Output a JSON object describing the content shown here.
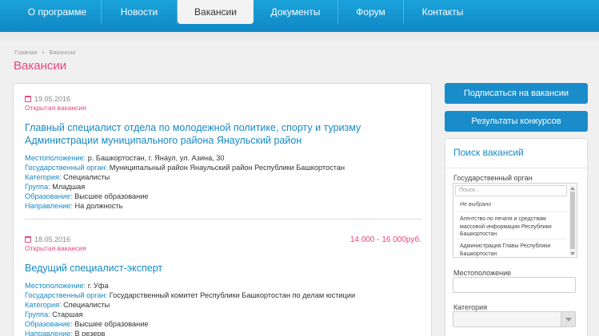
{
  "nav": {
    "items": [
      {
        "label": "О программе"
      },
      {
        "label": "Новости"
      },
      {
        "label": "Вакансии"
      },
      {
        "label": "Документы"
      },
      {
        "label": "Форум"
      },
      {
        "label": "Контакты"
      }
    ],
    "active_index": 2
  },
  "breadcrumb": {
    "home": "Главная",
    "current": "Вакансии"
  },
  "page_title": "Вакансии",
  "vacancies": [
    {
      "date": "19.05.2016",
      "status": "Открытая вакансия",
      "salary": "",
      "title": "Главный специалист отдела по молодежной политике, спорту и туризму Администрации муниципального района Янаульский район",
      "fields": [
        {
          "label": "Местоположение:",
          "value": "р. Башкортостан, г. Янаул, ул. Азина, 30"
        },
        {
          "label": "Государственный орган:",
          "value": "Муниципальный район Янаульский район Республики Башкортостан"
        },
        {
          "label": "Категория:",
          "value": "Специалисты"
        },
        {
          "label": "Группа:",
          "value": "Младшая"
        },
        {
          "label": "Образование:",
          "value": "Высшее образование"
        },
        {
          "label": "Направление:",
          "value": "На должность"
        }
      ]
    },
    {
      "date": "18.05.2016",
      "status": "Открытая вакансия",
      "salary": "14 000 - 16 000руб.",
      "title": "Ведущий специалист-эксперт",
      "fields": [
        {
          "label": "Местоположение:",
          "value": "г. Уфа"
        },
        {
          "label": "Государственный орган:",
          "value": "Государственный комитет Республики Башкортостан по делам юстиции"
        },
        {
          "label": "Категория:",
          "value": "Специалисты"
        },
        {
          "label": "Группа:",
          "value": "Старшая"
        },
        {
          "label": "Образование:",
          "value": "Высшее образование"
        },
        {
          "label": "Направление:",
          "value": "В резерв"
        }
      ]
    }
  ],
  "sidebar": {
    "subscribe_button": "Подписаться на вакансии",
    "results_button": "Результаты конкурсов",
    "search": {
      "title": "Поиск вакансий",
      "org_label": "Государственный орган",
      "org_search_placeholder": "Поиск...",
      "org_options": [
        "Не выбрано",
        "Агентство по печати и средствам массовой информации Республики Башкортостан",
        "Администрация Главы Республики Башкортостан"
      ],
      "location_label": "Местоположение",
      "location_value": "",
      "category_label": "Категория",
      "category_value": ""
    }
  },
  "colors": {
    "nav_bg": "#1296d3",
    "accent_pink": "#e6477a",
    "link_blue": "#1789c3",
    "button_blue": "#1a8cca"
  }
}
